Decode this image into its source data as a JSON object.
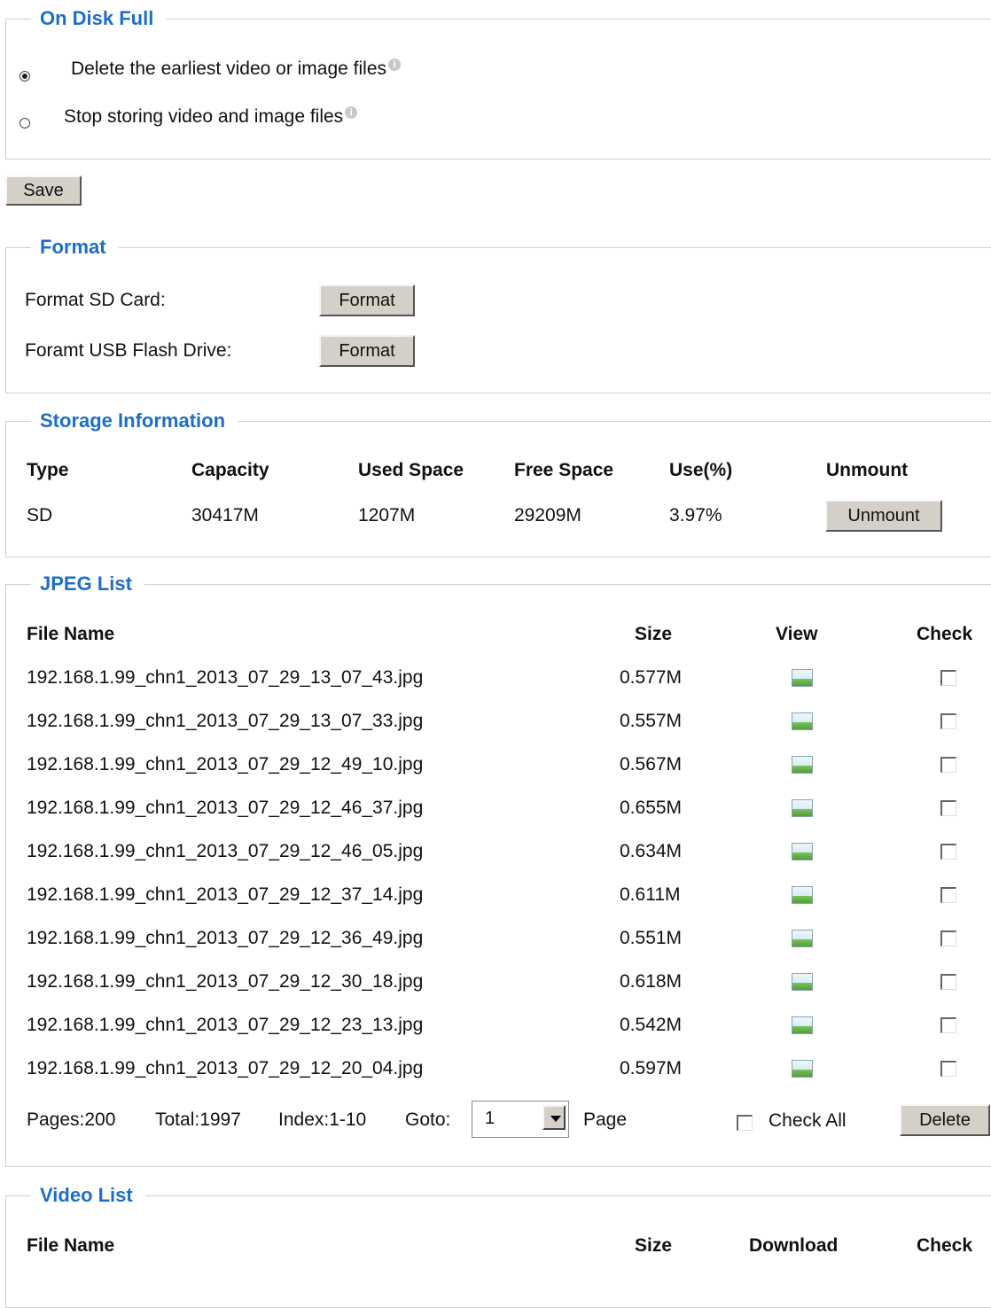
{
  "disk_full": {
    "legend": "On Disk Full",
    "option_delete": "Delete the earliest video or image files",
    "option_stop": "Stop storing video and image files",
    "selected": "delete"
  },
  "save_label": "Save",
  "format": {
    "legend": "Format",
    "sd_label": "Format SD Card:",
    "usb_label": "Foramt USB Flash Drive:",
    "button_label": "Format"
  },
  "storage": {
    "legend": "Storage Information",
    "headers": [
      "Type",
      "Capacity",
      "Used Space",
      "Free Space",
      "Use(%)",
      "Unmount"
    ],
    "row": {
      "type": "SD",
      "capacity": "30417M",
      "used": "1207M",
      "free": "29209M",
      "use_pct": "3.97%"
    },
    "unmount_label": "Unmount"
  },
  "jpeg": {
    "legend": "JPEG List",
    "headers": {
      "file": "File Name",
      "size": "Size",
      "view": "View",
      "check": "Check"
    },
    "files": [
      {
        "name": "192.168.1.99_chn1_2013_07_29_13_07_43.jpg",
        "size": "0.577M"
      },
      {
        "name": "192.168.1.99_chn1_2013_07_29_13_07_33.jpg",
        "size": "0.557M"
      },
      {
        "name": "192.168.1.99_chn1_2013_07_29_12_49_10.jpg",
        "size": "0.567M"
      },
      {
        "name": "192.168.1.99_chn1_2013_07_29_12_46_37.jpg",
        "size": "0.655M"
      },
      {
        "name": "192.168.1.99_chn1_2013_07_29_12_46_05.jpg",
        "size": "0.634M"
      },
      {
        "name": "192.168.1.99_chn1_2013_07_29_12_37_14.jpg",
        "size": "0.611M"
      },
      {
        "name": "192.168.1.99_chn1_2013_07_29_12_36_49.jpg",
        "size": "0.551M"
      },
      {
        "name": "192.168.1.99_chn1_2013_07_29_12_30_18.jpg",
        "size": "0.618M"
      },
      {
        "name": "192.168.1.99_chn1_2013_07_29_12_23_13.jpg",
        "size": "0.542M"
      },
      {
        "name": "192.168.1.99_chn1_2013_07_29_12_20_04.jpg",
        "size": "0.597M"
      }
    ],
    "pager": {
      "pages": "Pages:200",
      "total": "Total:1997",
      "index": "Index:1-10",
      "goto": "Goto:",
      "goto_value": "1",
      "page_word": "Page",
      "check_all": "Check All",
      "delete": "Delete"
    }
  },
  "video": {
    "legend": "Video List",
    "headers": {
      "file": "File Name",
      "size": "Size",
      "download": "Download",
      "check": "Check"
    }
  },
  "icons": {
    "info": "info-icon",
    "view": "image-view-icon",
    "dropdown": "chevron-down-icon"
  },
  "colors": {
    "legend": "#1e6ec8",
    "button_face": "#d4d0c8",
    "border": "#cfcfcf"
  }
}
